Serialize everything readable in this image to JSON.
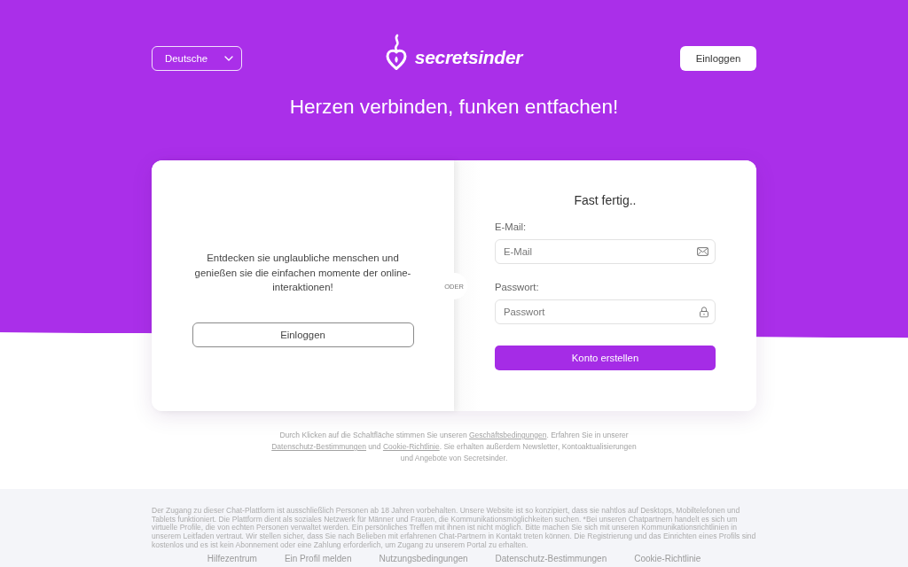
{
  "header": {
    "language_select": {
      "value": "Deutsche"
    },
    "logo": {
      "text": "secretsinder"
    },
    "login_button": {
      "label": "Einloggen"
    }
  },
  "tagline": "Herzen verbinden, funken entfachen!",
  "card": {
    "intro": {
      "text": "Entdecken sie unglaubliche menschen und genießen sie die einfachen momente der online-interaktionen!",
      "button": "Einloggen"
    },
    "separator": "ODER",
    "signup": {
      "title": "Fast fertig..",
      "fields": [
        {
          "kind": "email",
          "label": "E-Mail:",
          "placeholder": "E-Mail"
        },
        {
          "kind": "password",
          "label": "Passwort:",
          "placeholder": "Passwort"
        }
      ],
      "submit": "Konto erstellen"
    }
  },
  "consent": [
    {
      "kind": "text",
      "text": "Durch Klicken auf die Schaltfläche stimmen Sie unseren "
    },
    {
      "kind": "link",
      "text": "Geschäftsbedingungen"
    },
    {
      "kind": "text",
      "text": ". Erfahren Sie in unserer "
    },
    {
      "kind": "link",
      "text": "Datenschutz-Bestimmungen"
    },
    {
      "kind": "text",
      "text": " und "
    },
    {
      "kind": "link",
      "text": "Cookie-Richtlinie"
    },
    {
      "kind": "text",
      "text": ". Sie erhalten außerdem Newsletter, Kontoaktualisierungen und Angebote von Secretsinder."
    }
  ],
  "footer": {
    "disclaimer": "Der Zugang zu dieser Chat-Plattform ist ausschließlich Personen ab 18 Jahren vorbehalten. Unsere Website ist so konzipiert, dass sie nahtlos auf Desktops, Mobiltelefonen und Tablets funktioniert. Die Plattform dient als soziales Netzwerk für Männer und Frauen, die Kommunikationsmöglichkeiten suchen. *Bei unseren Chatpartnern handelt es sich um virtuelle Profile, die von echten Personen verwaltet werden. Ein persönliches Treffen mit ihnen ist nicht möglich. Bitte machen Sie sich mit unseren Kommunikationsrichtlinien in unserem Leitfaden vertraut. Wir stellen sicher, dass Sie nach Belieben mit erfahrenen Chat-Partnern in Kontakt treten können. Die Registrierung und das Einrichten eines Profils sind kostenlos und es ist kein Abonnement oder eine Zahlung erforderlich, um Zugang zu unserem Portal zu erhalten.",
    "links": [
      "Hilfezentrum",
      "Ein Profil melden",
      "Nutzungsbedingungen",
      "Datenschutz-Bestimmungen",
      "Cookie-Richtlinie"
    ]
  }
}
